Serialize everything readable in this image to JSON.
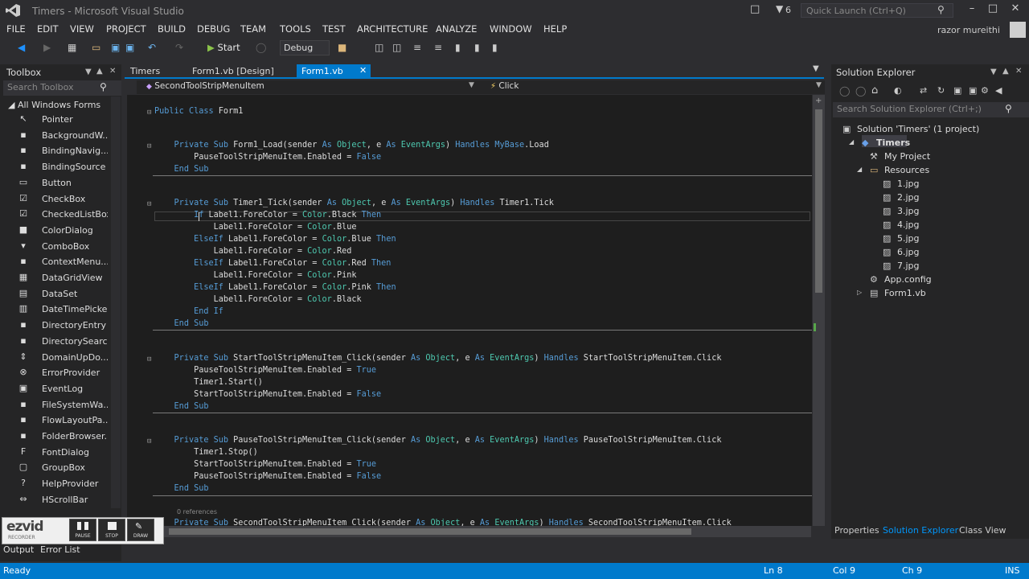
{
  "window": {
    "title": "Timers - Microsoft Visual Studio",
    "filter_count": "6",
    "quick_launch_placeholder": "Quick Launch (Ctrl+Q)"
  },
  "menu": [
    "FILE",
    "EDIT",
    "VIEW",
    "PROJECT",
    "BUILD",
    "DEBUG",
    "TEAM",
    "TOOLS",
    "TEST",
    "ARCHITECTURE",
    "ANALYZE",
    "WINDOW",
    "HELP"
  ],
  "user": {
    "name": "razor mureithi"
  },
  "toolbar": {
    "start_label": "Start",
    "configuration": "Debug"
  },
  "toolbox": {
    "title": "Toolbox",
    "search_placeholder": "Search Toolbox",
    "group": "All Windows Forms",
    "items": [
      {
        "label": "Pointer",
        "icon": "pointer-icon"
      },
      {
        "label": "BackgroundW...",
        "icon": "backgroundworker-icon"
      },
      {
        "label": "BindingNavig...",
        "icon": "bindingnavigator-icon"
      },
      {
        "label": "BindingSource",
        "icon": "bindingsource-icon"
      },
      {
        "label": "Button",
        "icon": "button-icon"
      },
      {
        "label": "CheckBox",
        "icon": "checkbox-icon"
      },
      {
        "label": "CheckedListBox",
        "icon": "checkedlistbox-icon"
      },
      {
        "label": "ColorDialog",
        "icon": "colordialog-icon"
      },
      {
        "label": "ComboBox",
        "icon": "combobox-icon"
      },
      {
        "label": "ContextMenu...",
        "icon": "contextmenu-icon"
      },
      {
        "label": "DataGridView",
        "icon": "datagridview-icon"
      },
      {
        "label": "DataSet",
        "icon": "dataset-icon"
      },
      {
        "label": "DateTimePicker",
        "icon": "datetimepicker-icon"
      },
      {
        "label": "DirectoryEntry",
        "icon": "directoryentry-icon"
      },
      {
        "label": "DirectorySearc...",
        "icon": "directorysearcher-icon"
      },
      {
        "label": "DomainUpDo...",
        "icon": "domainupdown-icon"
      },
      {
        "label": "ErrorProvider",
        "icon": "errorprovider-icon"
      },
      {
        "label": "EventLog",
        "icon": "eventlog-icon"
      },
      {
        "label": "FileSystemWa...",
        "icon": "filesystemwatcher-icon"
      },
      {
        "label": "FlowLayoutPa...",
        "icon": "flowlayoutpanel-icon"
      },
      {
        "label": "FolderBrowser...",
        "icon": "folderbrowser-icon"
      },
      {
        "label": "FontDialog",
        "icon": "fontdialog-icon"
      },
      {
        "label": "GroupBox",
        "icon": "groupbox-icon"
      },
      {
        "label": "HelpProvider",
        "icon": "helpprovider-icon"
      },
      {
        "label": "HScrollBar",
        "icon": "hscrollbar-icon"
      }
    ]
  },
  "tabs": [
    {
      "label": "Timers"
    },
    {
      "label": "Form1.vb [Design]"
    },
    {
      "label": "Form1.vb",
      "active": true
    }
  ],
  "navbar": {
    "left": "SecondToolStripMenuItem",
    "right": "Click"
  },
  "code": [
    "Public Class Form1",
    "",
    "",
    "    Private Sub Form1_Load(sender As Object, e As EventArgs) Handles MyBase.Load",
    "        PauseToolStripMenuItem.Enabled = False",
    "    End Sub",
    "",
    "",
    "    Private Sub Timer1_Tick(sender As Object, e As EventArgs) Handles Timer1.Tick",
    "        If Label1.ForeColor = Color.Black Then",
    "            Label1.ForeColor = Color.Blue",
    "        ElseIf Label1.ForeColor = Color.Blue Then",
    "            Label1.ForeColor = Color.Red",
    "        ElseIf Label1.ForeColor = Color.Red Then",
    "            Label1.ForeColor = Color.Pink",
    "        ElseIf Label1.ForeColor = Color.Pink Then",
    "            Label1.ForeColor = Color.Black",
    "        End If",
    "    End Sub",
    "",
    "",
    "    Private Sub StartToolStripMenuItem_Click(sender As Object, e As EventArgs) Handles StartToolStripMenuItem.Click",
    "        PauseToolStripMenuItem.Enabled = True",
    "        Timer1.Start()",
    "        StartToolStripMenuItem.Enabled = False",
    "    End Sub",
    "",
    "",
    "    Private Sub PauseToolStripMenuItem_Click(sender As Object, e As EventArgs) Handles PauseToolStripMenuItem.Click",
    "        Timer1.Stop()",
    "        StartToolStripMenuItem.Enabled = True",
    "        PauseToolStripMenuItem.Enabled = False",
    "    End Sub"
  ],
  "code_last_line": "    Private Sub SecondToolStripMenuItem_Click(sender As Object, e As EventArgs) Handles SecondToolStripMenuItem.Click",
  "references_hint": "0 references",
  "zoom": "",
  "solution_explorer": {
    "title": "Solution Explorer",
    "search_placeholder": "Search Solution Explorer (Ctrl+;)",
    "items": [
      {
        "label": "Solution 'Timers' (1 project)",
        "icon": "solution-icon"
      },
      {
        "label": "Timers",
        "icon": "vb-project-icon"
      },
      {
        "label": "My Project",
        "icon": "wrench-icon"
      },
      {
        "label": "Resources",
        "icon": "folder-icon"
      },
      {
        "label": "1.jpg",
        "icon": "image-file-icon"
      },
      {
        "label": "2.jpg",
        "icon": "image-file-icon"
      },
      {
        "label": "3.jpg",
        "icon": "image-file-icon"
      },
      {
        "label": "4.jpg",
        "icon": "image-file-icon"
      },
      {
        "label": "5.jpg",
        "icon": "image-file-icon"
      },
      {
        "label": "6.jpg",
        "icon": "image-file-icon"
      },
      {
        "label": "7.jpg",
        "icon": "image-file-icon"
      },
      {
        "label": "App.config",
        "icon": "config-file-icon"
      },
      {
        "label": "Form1.vb",
        "icon": "form-icon"
      }
    ],
    "bottom_tabs": [
      "Properties",
      "Solution Explorer",
      "Class View"
    ]
  },
  "bottom_tabs": [
    "Output",
    "Error List"
  ],
  "status": {
    "text": "Ready",
    "line": "Ln 8",
    "col": "Col 9",
    "ch": "Ch 9",
    "mode": "INS"
  },
  "ezvid": {
    "logo": "ezvid",
    "subtitle": "RECORDER",
    "buttons": [
      "PAUSE",
      "STOP",
      "DRAW"
    ]
  },
  "colors": {
    "accent": "#007acc",
    "keyword": "#569cd6",
    "type": "#4ec9b0",
    "background": "#1e1e1e"
  }
}
